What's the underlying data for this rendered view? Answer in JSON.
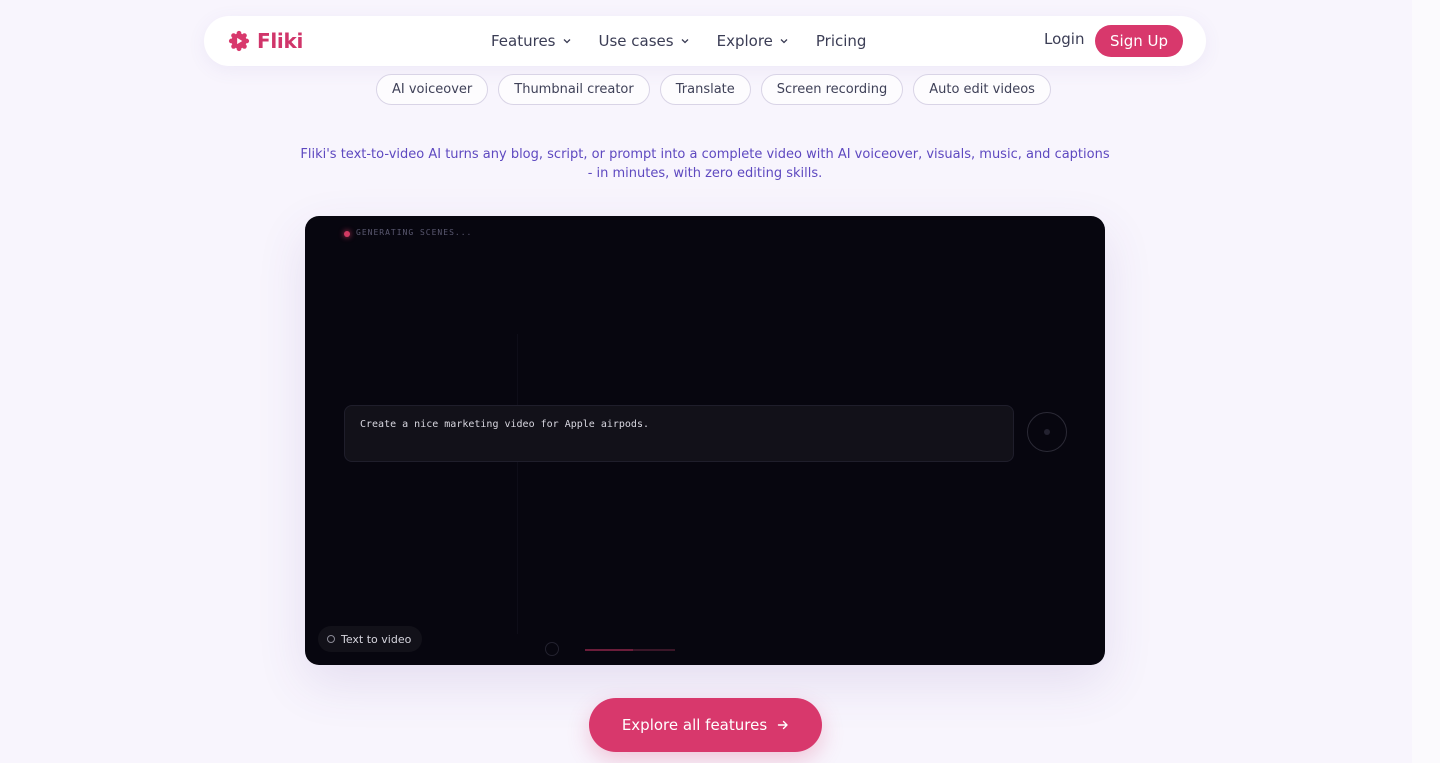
{
  "brand": {
    "name": "Fliki",
    "accent_color": "#d8386c"
  },
  "nav": {
    "items": [
      {
        "label": "Features",
        "has_dropdown": true
      },
      {
        "label": "Use cases",
        "has_dropdown": true
      },
      {
        "label": "Explore",
        "has_dropdown": true
      },
      {
        "label": "Pricing",
        "has_dropdown": false
      }
    ],
    "login_label": "Login",
    "signup_label": "Sign Up"
  },
  "chips": [
    "AI voiceover",
    "Thumbnail creator",
    "Translate",
    "Screen recording",
    "Auto edit videos"
  ],
  "description": "Fliki's text-to-video AI turns any blog, script, or prompt into a complete video with AI voiceover, visuals, music, and captions - in minutes, with zero editing skills.",
  "video": {
    "status_text": "GENERATING SCENES...",
    "prompt_text": "Create a nice marketing video for Apple airpods.",
    "mode_tag": "Text to video"
  },
  "cta": {
    "label": "Explore all features"
  },
  "icons": {
    "logo": "fliki-logo-icon",
    "dropdown": "chevron-down-icon",
    "cta_arrow": "arrow-right-icon",
    "record": "record-button-icon"
  }
}
